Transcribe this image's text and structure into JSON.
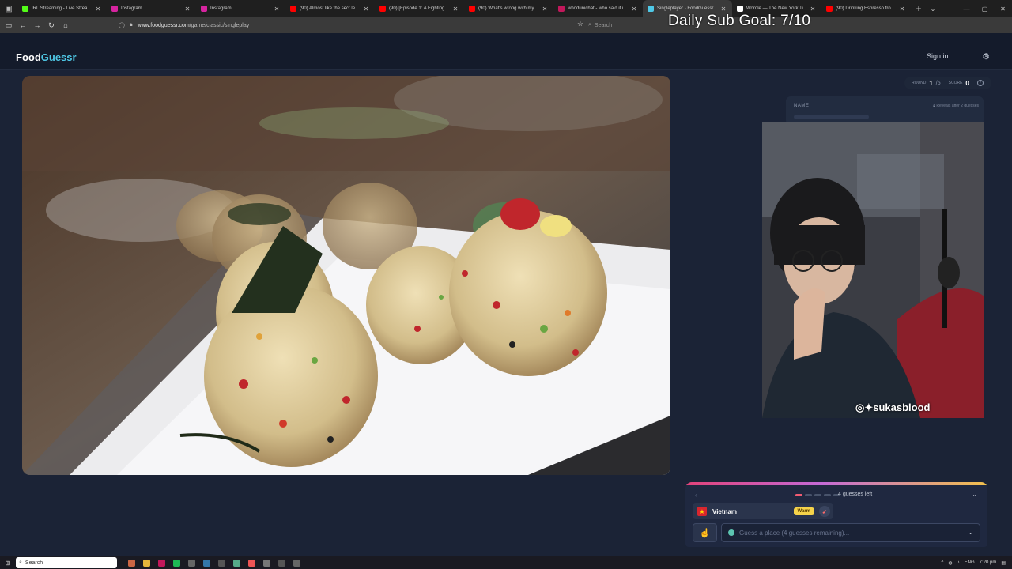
{
  "browser": {
    "tabs": [
      {
        "title": "IRL Streaming - Live Streams o",
        "color": "#53fc18"
      },
      {
        "title": "Instagram",
        "color": "#d6249f"
      },
      {
        "title": "Instagram",
        "color": "#d6249f"
      },
      {
        "title": "(90) Almost like the sect leader",
        "color": "#ff0000"
      },
      {
        "title": "(90) [Episode 1: A Fighting Cha",
        "color": "#ff0000"
      },
      {
        "title": "(90) What's wrong with my nam",
        "color": "#ff0000"
      },
      {
        "title": "whodunichat - who said it in yo",
        "color": "#c2185b"
      },
      {
        "title": "Singleplayer - FoodGuessr",
        "color": "#4fc8e6"
      },
      {
        "title": "Wordle — The New York Times",
        "color": "#ffffff"
      },
      {
        "title": "(90) Drinking Espresso from th",
        "color": "#ff0000"
      }
    ],
    "url_host": "www.foodguessr.com",
    "url_path": "/game/classic/singleplay",
    "search_placeholder": "Search"
  },
  "stream_overlay": {
    "goal_text": "Daily Sub Goal: 7/10",
    "handle": "sukasblood"
  },
  "app": {
    "logo_main": "Food",
    "logo_accent": "Guessr",
    "signin": "Sign in"
  },
  "status": {
    "round_label": "ROUND",
    "round_value": "1",
    "round_total": "/5",
    "score_label": "SCORE",
    "score_value": "0"
  },
  "name_card": {
    "label": "NAME",
    "reveal_text": "Reveals after 2 guesses"
  },
  "guess_panel": {
    "guesses_left": "4 guesses left",
    "guess_country": "Vietnam",
    "guess_temp": "Warm",
    "input_placeholder": "Guess a place (4 guesses remaining)..."
  },
  "taskbar": {
    "search_label": "Search",
    "lang": "ENG",
    "time": "7:20 pm"
  },
  "colors": {
    "accent": "#4fc8e6",
    "warm": "#f6d34a",
    "background": "#1b2336"
  }
}
